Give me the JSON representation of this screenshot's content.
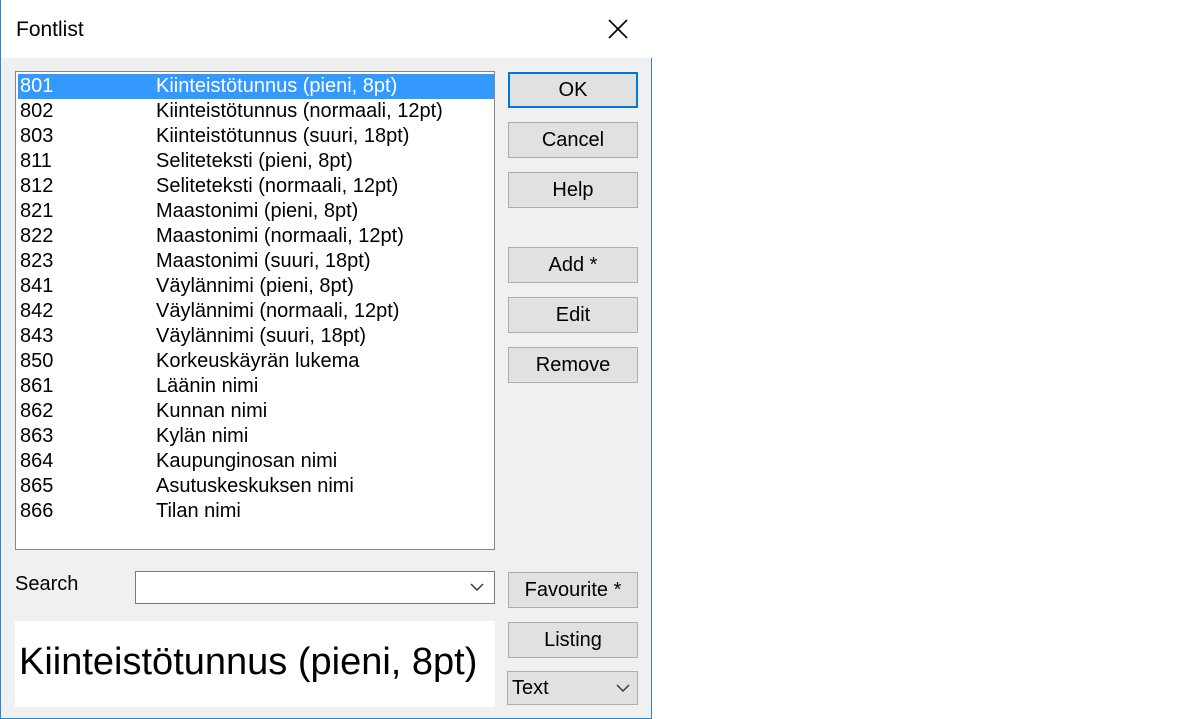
{
  "window": {
    "title": "Fontlist"
  },
  "fontlist": {
    "selected_index": 0,
    "items": [
      {
        "code": "801",
        "name": "Kiinteistötunnus (pieni, 8pt)"
      },
      {
        "code": "802",
        "name": "Kiinteistötunnus (normaali, 12pt)"
      },
      {
        "code": "803",
        "name": "Kiinteistötunnus (suuri, 18pt)"
      },
      {
        "code": "811",
        "name": "Seliteteksti (pieni, 8pt)"
      },
      {
        "code": "812",
        "name": "Seliteteksti (normaali, 12pt)"
      },
      {
        "code": "821",
        "name": "Maastonimi (pieni, 8pt)"
      },
      {
        "code": "822",
        "name": "Maastonimi (normaali, 12pt)"
      },
      {
        "code": "823",
        "name": "Maastonimi (suuri, 18pt)"
      },
      {
        "code": "841",
        "name": "Väylännimi (pieni, 8pt)"
      },
      {
        "code": "842",
        "name": "Väylännimi (normaali, 12pt)"
      },
      {
        "code": "843",
        "name": "Väylännimi (suuri, 18pt)"
      },
      {
        "code": "850",
        "name": "Korkeuskäyrän lukema"
      },
      {
        "code": "861",
        "name": "Läänin nimi"
      },
      {
        "code": "862",
        "name": "Kunnan nimi"
      },
      {
        "code": "863",
        "name": "Kylän nimi"
      },
      {
        "code": "864",
        "name": "Kaupunginosan nimi"
      },
      {
        "code": "865",
        "name": "Asutuskeskuksen nimi"
      },
      {
        "code": "866",
        "name": "Tilan nimi"
      }
    ]
  },
  "buttons": {
    "ok": "OK",
    "cancel": "Cancel",
    "help": "Help",
    "add": "Add *",
    "edit": "Edit",
    "remove": "Remove",
    "favourite": "Favourite *",
    "listing": "Listing"
  },
  "search": {
    "label": "Search",
    "value": ""
  },
  "preview": {
    "text": "Kiinteistötunnus (pieni, 8pt)"
  },
  "type_select": {
    "value": "Text"
  },
  "colors": {
    "selection": "#3399ff",
    "window_border": "#2b87c8",
    "default_button_border": "#0078d7"
  },
  "icons": {
    "close": "close-icon",
    "dropdown": "chevron-down-icon"
  }
}
